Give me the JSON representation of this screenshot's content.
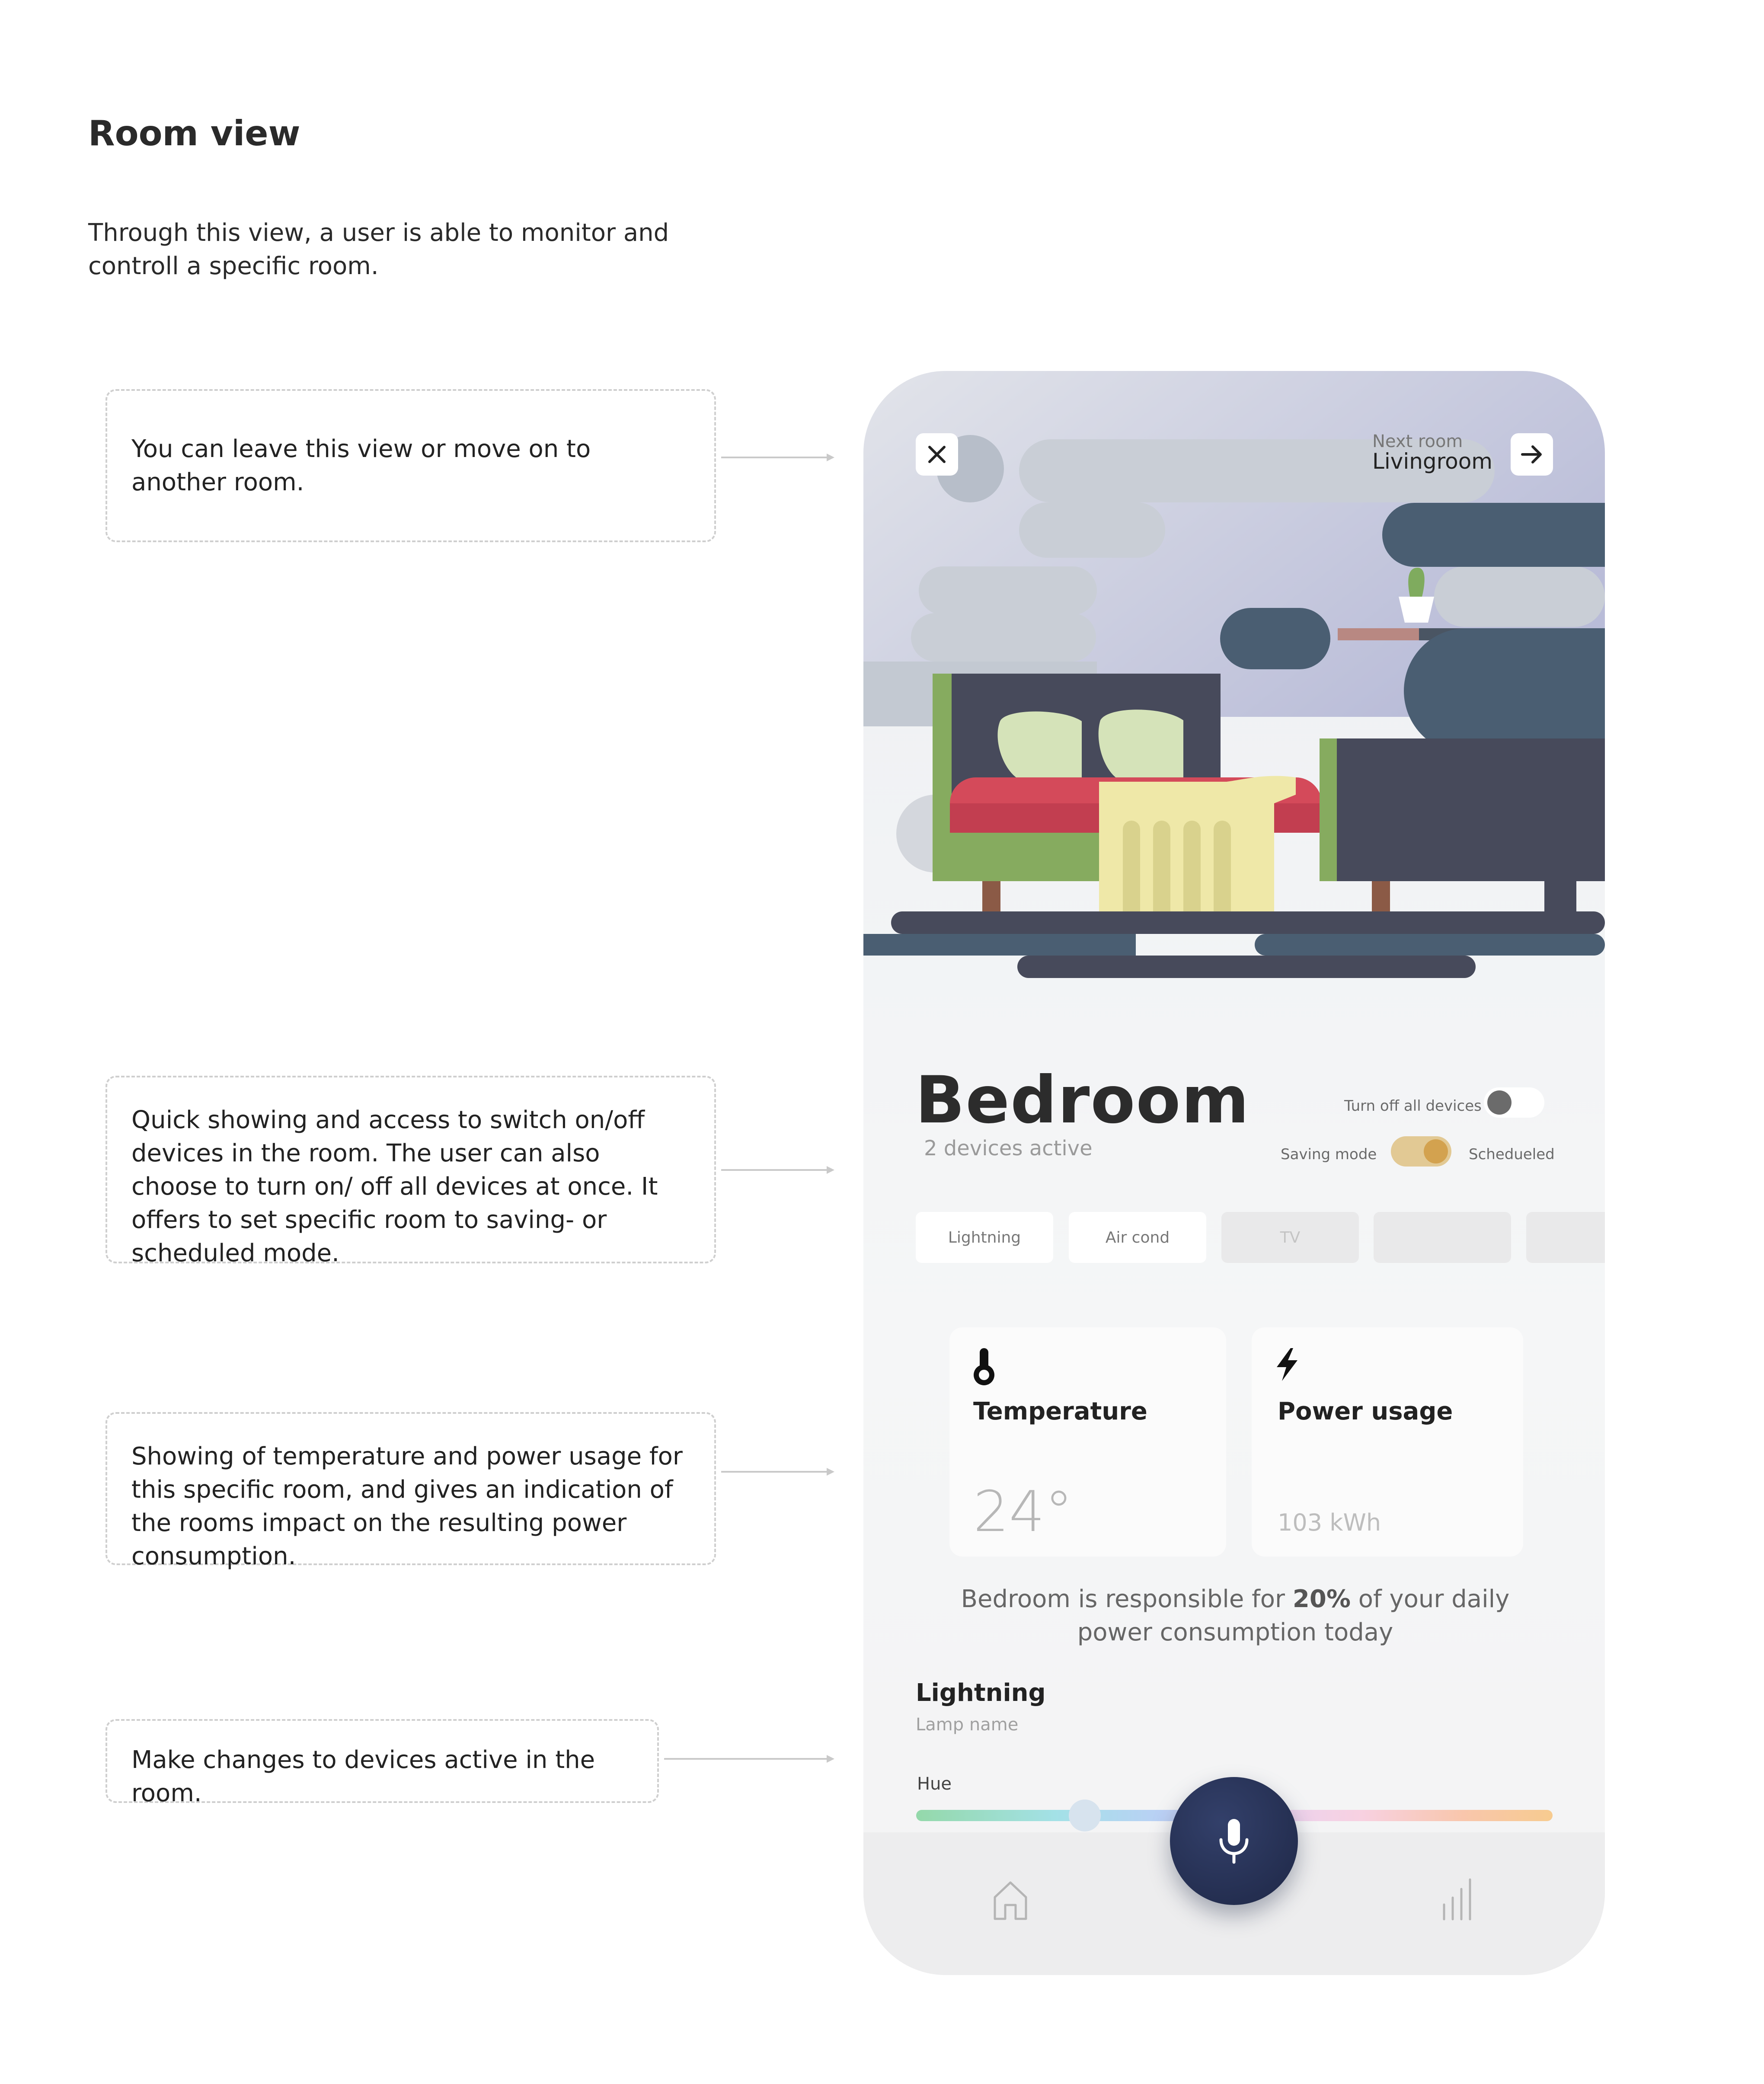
{
  "page": {
    "title": "Room view",
    "intro": "Through this view, a user is able to monitor and controll a specific room."
  },
  "notes": [
    "You can leave this view or move on to another room.",
    "Quick showing and access to switch on/off devices in the room. The user can also choose to turn on/ off all devices at once. It offers to set specific room to saving- or scheduled mode.",
    "Showing of temperature and power usage for this specific room, and gives an indication of the rooms impact on the resulting power consumption.",
    "Make changes to devices active in the room."
  ],
  "header": {
    "close_icon": "close-icon",
    "next_label": "Next room",
    "next_room": "Livingroom",
    "next_icon": "arrow-right-icon"
  },
  "room": {
    "name": "Bedroom",
    "active": "2 devices active",
    "turn_off_label": "Turn off all devices",
    "turn_off_all": false,
    "saving_label": "Saving mode",
    "scheduled_label": "Schedueled",
    "mode_scheduled": true,
    "toggle_color": "#d3a24f"
  },
  "chips": [
    {
      "label": "Lightning",
      "active": true
    },
    {
      "label": "Air cond",
      "active": true
    },
    {
      "label": "TV",
      "active": false
    },
    {
      "label": "",
      "active": false
    },
    {
      "label": "",
      "active": false
    }
  ],
  "cards": {
    "temperature": {
      "title": "Temperature",
      "value": "24°",
      "icon": "thermometer-icon"
    },
    "power": {
      "title": "Power usage",
      "value": "103 kWh",
      "icon": "lightning-bolt-icon"
    }
  },
  "summary": {
    "prefix": "Bedroom is responsible for ",
    "percent": "20%",
    "suffix": " of your daily power consumption today"
  },
  "lighting": {
    "title": "Lightning",
    "sub": "Lamp name",
    "hue_label": "Hue",
    "hue_value": 0.265
  },
  "nav": {
    "home_icon": "home-icon",
    "mic_icon": "microphone-icon",
    "stats_icon": "bar-chart-icon"
  }
}
